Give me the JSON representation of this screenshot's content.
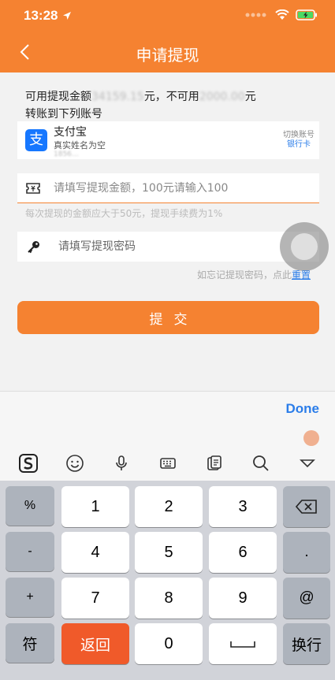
{
  "status": {
    "time": "13:28"
  },
  "nav": {
    "title": "申请提现"
  },
  "balance": {
    "prefix": "可用提现金额",
    "available_blurred": "34159.15",
    "middle": "元，不可用",
    "unavailable_blurred": "2000.00",
    "suffix": "元"
  },
  "transfer_label": "转账到下列账号",
  "account": {
    "name": "支付宝",
    "subtitle": "真实姓名为空",
    "id_blurred": "1856…",
    "switch_label": "切换账号",
    "switch_card": "银行卡"
  },
  "amount_field": {
    "placeholder": "请填写提现金额，100元请输入100",
    "value": ""
  },
  "fee_hint": "每次提现的金额应大于50元，提现手续费为1%",
  "password_field": {
    "placeholder": "请填写提现密码",
    "value": ""
  },
  "forgot": {
    "text": "如忘记提现密码，点此",
    "link": "重置"
  },
  "submit_label": "提交",
  "keyboard": {
    "done_label": "Done",
    "symbols": [
      "%",
      "-",
      "+",
      "×"
    ],
    "digits": [
      "1",
      "2",
      "3",
      "4",
      "5",
      "6",
      "7",
      "8",
      "9",
      "0"
    ],
    "right_keys": [
      ".",
      "@"
    ],
    "sym_key": "符",
    "back_key": "返回",
    "newline_key": "换行"
  }
}
